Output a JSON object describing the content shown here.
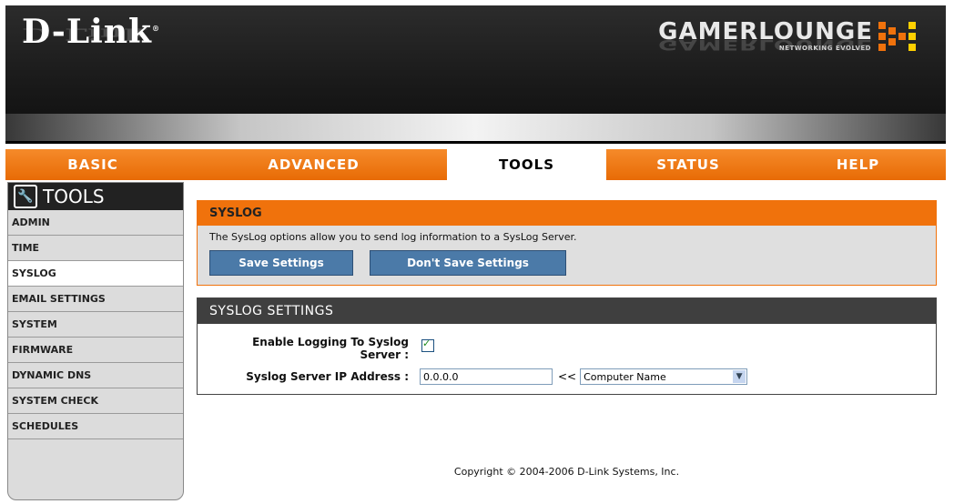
{
  "header": {
    "logo": "D-Link",
    "logo_reg": "®",
    "brand": "GAMERLOUNGE",
    "brand_tagline": "NETWORKING EVOLVED"
  },
  "nav": {
    "tabs": [
      {
        "label": "BASIC",
        "active": false
      },
      {
        "label": "ADVANCED",
        "active": false
      },
      {
        "label": "TOOLS",
        "active": true
      },
      {
        "label": "STATUS",
        "active": false
      },
      {
        "label": "HELP",
        "active": false
      }
    ]
  },
  "sidebar": {
    "title": "TOOLS",
    "items": [
      {
        "label": "ADMIN",
        "active": false
      },
      {
        "label": "TIME",
        "active": false
      },
      {
        "label": "SYSLOG",
        "active": true
      },
      {
        "label": "EMAIL SETTINGS",
        "active": false
      },
      {
        "label": "SYSTEM",
        "active": false
      },
      {
        "label": "FIRMWARE",
        "active": false
      },
      {
        "label": "DYNAMIC DNS",
        "active": false
      },
      {
        "label": "SYSTEM CHECK",
        "active": false
      },
      {
        "label": "SCHEDULES",
        "active": false
      }
    ]
  },
  "syslog": {
    "title": "SYSLOG",
    "description": "The SysLog options allow you to send log information to a SysLog Server.",
    "save_label": "Save Settings",
    "dont_save_label": "Don't Save Settings"
  },
  "settings": {
    "title": "SYSLOG SETTINGS",
    "enable_label_line1": "Enable Logging To Syslog",
    "enable_label_line2": "Server :",
    "enable_checked": true,
    "ip_label": "Syslog Server IP Address :",
    "ip_value": "0.0.0.0",
    "arrows": "<<",
    "computer_select": "Computer Name"
  },
  "footer": {
    "copyright": "Copyright © 2004-2006 D-Link Systems, Inc."
  },
  "colors": {
    "accent": "#f0720c",
    "button": "#4b7aa8",
    "dark_bar": "#3f3f3f"
  }
}
